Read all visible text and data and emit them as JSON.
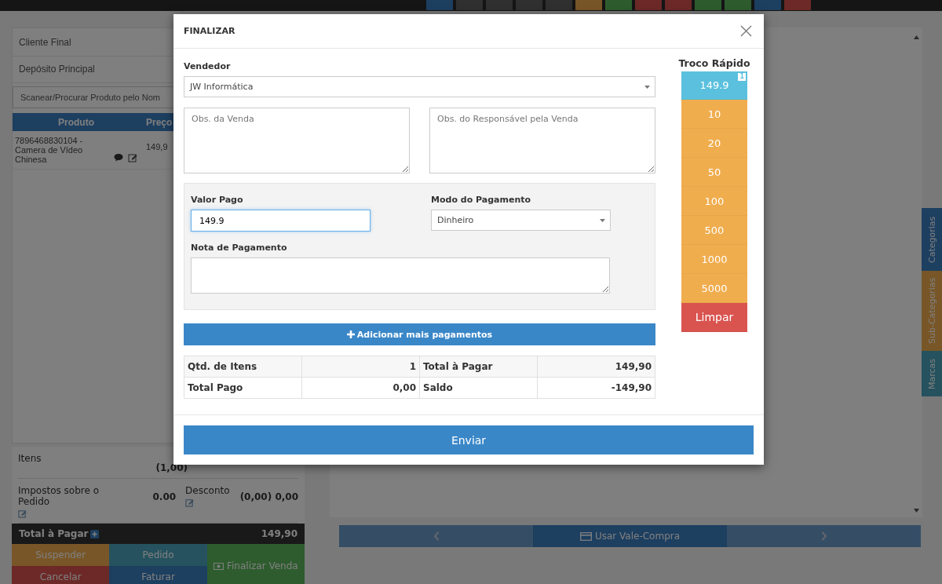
{
  "top_bar": {
    "buttons": [
      {
        "kind": "primary"
      },
      {
        "kind": "default"
      },
      {
        "kind": "default"
      },
      {
        "kind": "default"
      },
      {
        "kind": "default"
      },
      {
        "kind": "warning"
      },
      {
        "kind": "success"
      },
      {
        "kind": "danger"
      },
      {
        "kind": "danger"
      },
      {
        "kind": "success"
      },
      {
        "kind": "success"
      },
      {
        "kind": "primary"
      },
      {
        "kind": "danger"
      }
    ]
  },
  "left_panel": {
    "customer": "Cliente Final",
    "warehouse": "Depósito Principal",
    "search": {
      "placeholder": "Scanear/Procurar Produto pelo Nom"
    },
    "columns": [
      "Produto",
      "Preço"
    ],
    "rows": [
      {
        "product": "7896468830104 - Camera de Vídeo Chinesa",
        "price": "149,9"
      }
    ],
    "summary": {
      "items_label": "Itens",
      "items_qty": "(1,00)",
      "tax_label": "Impostos sobre o Pedido",
      "tax_value": "0.00",
      "discount_label": "Desconto",
      "discount_value": "(0,00) 0,00"
    },
    "total": {
      "label": "Total à Pagar",
      "value": "149,90"
    },
    "actions": [
      {
        "label": "Suspender",
        "kind": "warning"
      },
      {
        "label": "Pedido",
        "kind": "info"
      },
      {
        "label": "Cancelar",
        "kind": "danger"
      },
      {
        "label": "Faturar",
        "kind": "primary"
      },
      {
        "label": "Finalizar Venda",
        "kind": "success"
      }
    ]
  },
  "carousel": {
    "label": "Usar Vale-Compra"
  },
  "side_tabs": [
    {
      "label": "Categorias",
      "kind": "primary"
    },
    {
      "label": "Sub-Categorias",
      "kind": "warning"
    },
    {
      "label": "Marcas",
      "kind": "info"
    }
  ],
  "modal": {
    "title": "FINALIZAR",
    "seller": {
      "label": "Vendedor",
      "value": "JW Informática"
    },
    "sale_notes": {
      "placeholder": "Obs. da Venda"
    },
    "responsible_notes": {
      "placeholder": "Obs. do Responsável pela Venda"
    },
    "payment": {
      "amount_label": "Valor Pago",
      "amount": "149.9",
      "mode_label": "Modo do Pagamento",
      "mode": "Dinheiro",
      "note_label": "Nota de Pagamento"
    },
    "add_payment": "Adicionar mais pagamentos",
    "totals": [
      [
        "Qtd. de Itens",
        "1",
        "Total à Pagar",
        "149,90"
      ],
      [
        "Total Pago",
        "0,00",
        "Saldo",
        "-149,90"
      ]
    ],
    "submit": "Enviar",
    "quick_change": {
      "title": "Troco Rápido",
      "items": [
        {
          "label": "149.9",
          "kind": "exact",
          "badge": "1"
        },
        {
          "label": "10",
          "kind": "note"
        },
        {
          "label": "20",
          "kind": "note"
        },
        {
          "label": "50",
          "kind": "note"
        },
        {
          "label": "100",
          "kind": "note"
        },
        {
          "label": "500",
          "kind": "note"
        },
        {
          "label": "1000",
          "kind": "note"
        },
        {
          "label": "5000",
          "kind": "note"
        },
        {
          "label": "Limpar",
          "kind": "clear"
        }
      ]
    }
  }
}
